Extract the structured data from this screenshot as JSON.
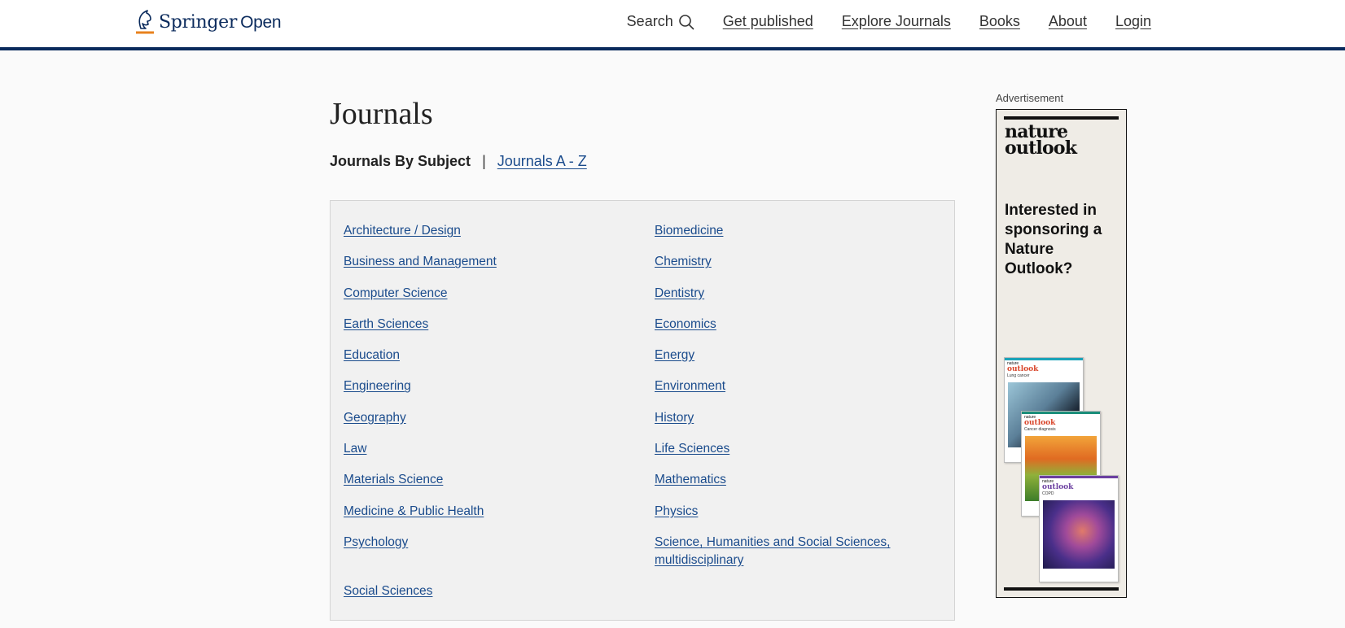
{
  "header": {
    "logo": {
      "brand": "Springer",
      "suffix": "Open"
    },
    "nav": {
      "search_label": "Search",
      "items": [
        {
          "label": "Get published"
        },
        {
          "label": "Explore Journals"
        },
        {
          "label": "Books"
        },
        {
          "label": "About"
        },
        {
          "label": "Login"
        }
      ]
    }
  },
  "main": {
    "title": "Journals",
    "subject_nav": {
      "current": "Journals By Subject",
      "separator": "|",
      "link": "Journals A - Z"
    },
    "subjects": [
      "Architecture / Design",
      "Biomedicine",
      "Business and Management",
      "Chemistry",
      "Computer Science",
      "Dentistry",
      "Earth Sciences",
      "Economics",
      "Education",
      "Energy",
      "Engineering",
      "Environment",
      "Geography",
      "History",
      "Law",
      "Life Sciences",
      "Materials Science",
      "Mathematics",
      "Medicine & Public Health",
      "Physics",
      "Psychology",
      "Science, Humanities and Social Sciences, multidisciplinary",
      "Social Sciences"
    ]
  },
  "ad": {
    "label": "Advertisement",
    "brand_line1": "nature",
    "brand_line2": "outlook",
    "headline": "Interested in sponsoring a Nature Outlook?",
    "covers": [
      {
        "small": "nature",
        "title": "outlook",
        "topic": "Lung cancer",
        "accent": "#1aa3b8",
        "title_color": "#d8452a"
      },
      {
        "small": "nature",
        "title": "outlook",
        "topic": "Cancer diagnosis",
        "accent": "#1b8e7a",
        "title_color": "#d8452a"
      },
      {
        "small": "nature",
        "title": "outlook",
        "topic": "COPD",
        "accent": "#6b3fa0",
        "title_color": "#6b3fa0"
      }
    ]
  },
  "colors": {
    "brand_navy": "#0a2a5c",
    "link_blue": "#1a4b8c",
    "logo_accent": "#e8821e"
  }
}
